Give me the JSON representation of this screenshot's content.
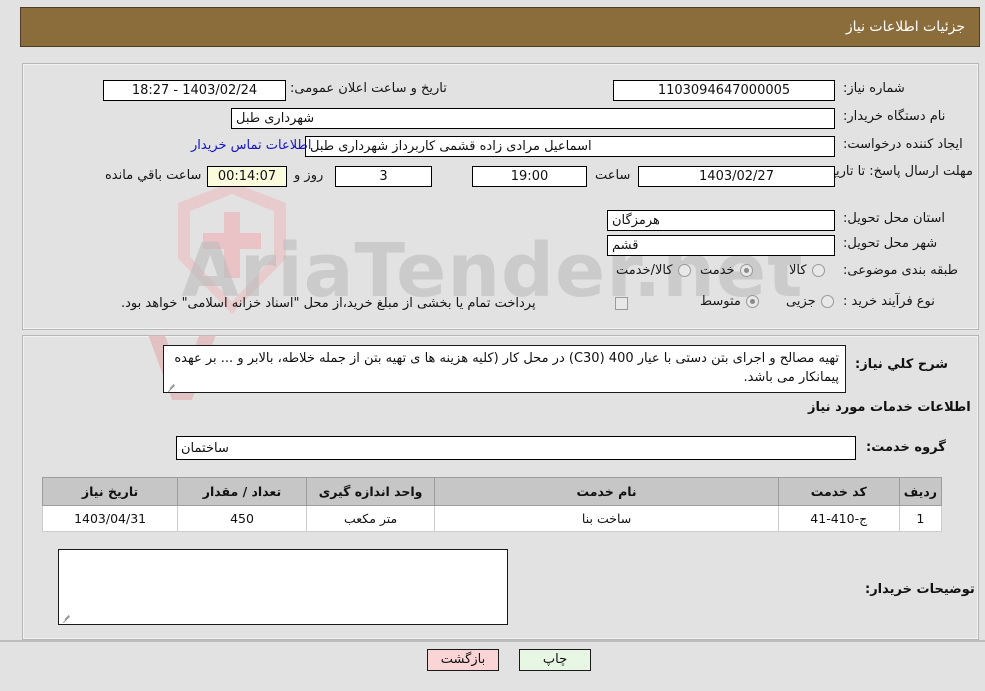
{
  "header": {
    "title": "جزئیات اطلاعات نیاز"
  },
  "watermark": {
    "text": "AriaTender.net",
    "mark": "V"
  },
  "top_form": {
    "need_number": {
      "label": "شماره نیاز:",
      "value": "1103094647000005"
    },
    "public_announce": {
      "label": "تاریخ و ساعت اعلان عمومی:",
      "value": "1403/02/24 - 18:27"
    },
    "buyer_org": {
      "label": "نام دستگاه خریدار:",
      "value": "شهرداری طبل"
    },
    "creator": {
      "label": "ایجاد کننده درخواست:",
      "value": "اسماعیل  مرادی زاده قشمی کاربرداز شهرداری طبل"
    },
    "contact_link": "اطلاعات تماس خریدار",
    "deadline": {
      "label": "مهلت ارسال پاسخ: تا تاریخ:",
      "date": "1403/02/27",
      "time_label": "ساعت",
      "time": "19:00",
      "days": "3",
      "days_label": "روز و",
      "countdown": "00:14:07",
      "remaining_label": "ساعت باقي مانده"
    },
    "province": {
      "label": "استان محل تحویل:",
      "value": "هرمزگان"
    },
    "city": {
      "label": "شهر محل تحویل:",
      "value": "قشم"
    },
    "category": {
      "label": "طبقه بندی موضوعی:",
      "options": [
        {
          "label": "کالا",
          "selected": false
        },
        {
          "label": "خدمت",
          "selected": true
        },
        {
          "label": "کالا/خدمت",
          "selected": false
        }
      ]
    },
    "process_type": {
      "label": "نوع فرآیند خرید :",
      "options": [
        {
          "label": "جزیی",
          "selected": false
        },
        {
          "label": "متوسط",
          "selected": true
        }
      ],
      "checkbox_text": "پرداخت تمام یا بخشی از مبلغ خرید،از محل \"اسناد خزانه اسلامی\" خواهد بود.",
      "checkbox_checked": false
    }
  },
  "bottom": {
    "general_desc_label": "شرح کلي نياز:",
    "general_desc_value": "تهیه مصالح و اجرای بتن دستی با عیار 400 (C30)  در محل کار (کلیه هزینه ها ی تهیه بتن از جمله خلاطه، بالابر و ... بر عهده پیمانکار می باشد.",
    "services_title": "اطلاعات خدمات مورد نیاز",
    "service_group_label": "گروه خدمت:",
    "service_group_value": "ساختمان",
    "table": {
      "columns": [
        "ردیف",
        "کد خدمت",
        "نام خدمت",
        "واحد اندازه گیری",
        "تعداد / مقدار",
        "تاریخ نیاز"
      ],
      "rows": [
        {
          "row_no": "1",
          "service_code": "ج-410-41",
          "service_name": "ساخت بنا",
          "unit": "متر مکعب",
          "quantity": "450",
          "need_date": "1403/04/31"
        }
      ]
    },
    "comments_label": "توضیحات خریدار:",
    "comments_value": ""
  },
  "buttons": {
    "print": "چاپ",
    "back": "بازگشت"
  },
  "colors": {
    "header_bg": "#8a6d3b",
    "page_bg": "#e2e2e2",
    "link": "#1414c8",
    "timer_bg": "#fbfbdd",
    "btn_back_bg": "#fbd5d5",
    "btn_print_bg": "#e8f7e4",
    "table_header_bg": "#c6c6c6"
  }
}
